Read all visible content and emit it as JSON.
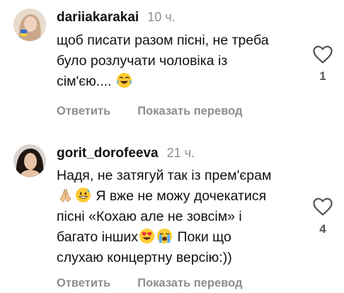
{
  "comments": [
    {
      "username": "dariiakarakai",
      "time": "10 ч.",
      "lines": [
        "щоб писати разом пісні, не треба",
        "було розлучати чоловіка із",
        "сім'єю.... "
      ],
      "likes": "1",
      "reply_label": "Ответить",
      "translate_label": "Показать перевод",
      "icons": [
        "avatar",
        "face-with-tears-of-joy-emoji",
        "heart-outline-icon"
      ]
    },
    {
      "username": "gorit_dorofeeva",
      "time": "21 ч.",
      "lines": [
        "Надя, не затягуй так із прем'єрам",
        " Я вже не можу дочекатися",
        "пісні «Кохаю але не зовсім» і",
        "багато інших Поки що",
        "слухаю концертну версію:))"
      ],
      "line2_text": " Я вже не можу дочекатися",
      "line4_part1": "багато інших",
      "line4_part2": " Поки що",
      "likes": "4",
      "reply_label": "Ответить",
      "translate_label": "Показать перевод",
      "icons": [
        "avatar",
        "folded-hands-emoji",
        "grinning-sweat-emoji",
        "heart-eyes-emoji",
        "loudly-crying-emoji",
        "heart-outline-icon"
      ]
    }
  ],
  "colors": {
    "text": "#111111",
    "muted": "#8e8e8e"
  }
}
